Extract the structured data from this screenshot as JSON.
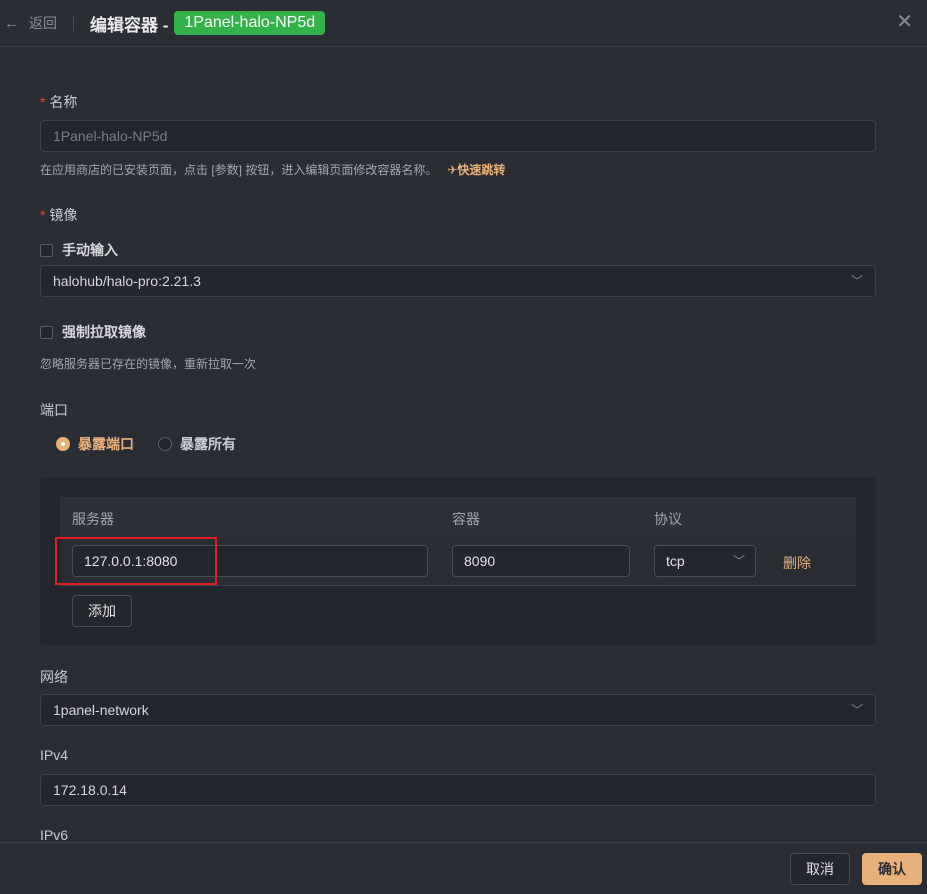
{
  "header": {
    "back_label": "返回",
    "title": "编辑容器 -",
    "container_tag": "1Panel-halo-NP5d"
  },
  "form": {
    "name": {
      "label": "名称",
      "value": "1Panel-halo-NP5d",
      "hint": "在应用商店的已安装页面，点击 [参数] 按钮，进入编辑页面修改容器名称。",
      "jump_label": "快速跳转"
    },
    "image": {
      "label": "镜像",
      "manual_input_label": "手动输入",
      "value": "halohub/halo-pro:2.21.3",
      "force_pull_label": "强制拉取镜像",
      "force_pull_hint": "忽略服务器已存在的镜像，重新拉取一次"
    },
    "ports": {
      "label": "端口",
      "options": [
        {
          "label": "暴露端口",
          "selected": true
        },
        {
          "label": "暴露所有",
          "selected": false
        }
      ],
      "table": {
        "headers": {
          "server": "服务器",
          "container": "容器",
          "protocol": "协议"
        },
        "rows": [
          {
            "server": "127.0.0.1:8080",
            "container": "8090",
            "protocol": "tcp",
            "delete_label": "删除"
          }
        ],
        "add_label": "添加"
      }
    },
    "network": {
      "label": "网络",
      "value": "1panel-network"
    },
    "ipv4": {
      "label": "IPv4",
      "value": "172.18.0.14"
    },
    "ipv6": {
      "label": "IPv6"
    }
  },
  "footer": {
    "cancel_label": "取消",
    "confirm_label": "确认"
  },
  "colors": {
    "accent": "#e9b17a",
    "tag_green": "#34b24a",
    "required": "#e0503a",
    "highlight": "#e02020",
    "background": "#2b2d35"
  }
}
